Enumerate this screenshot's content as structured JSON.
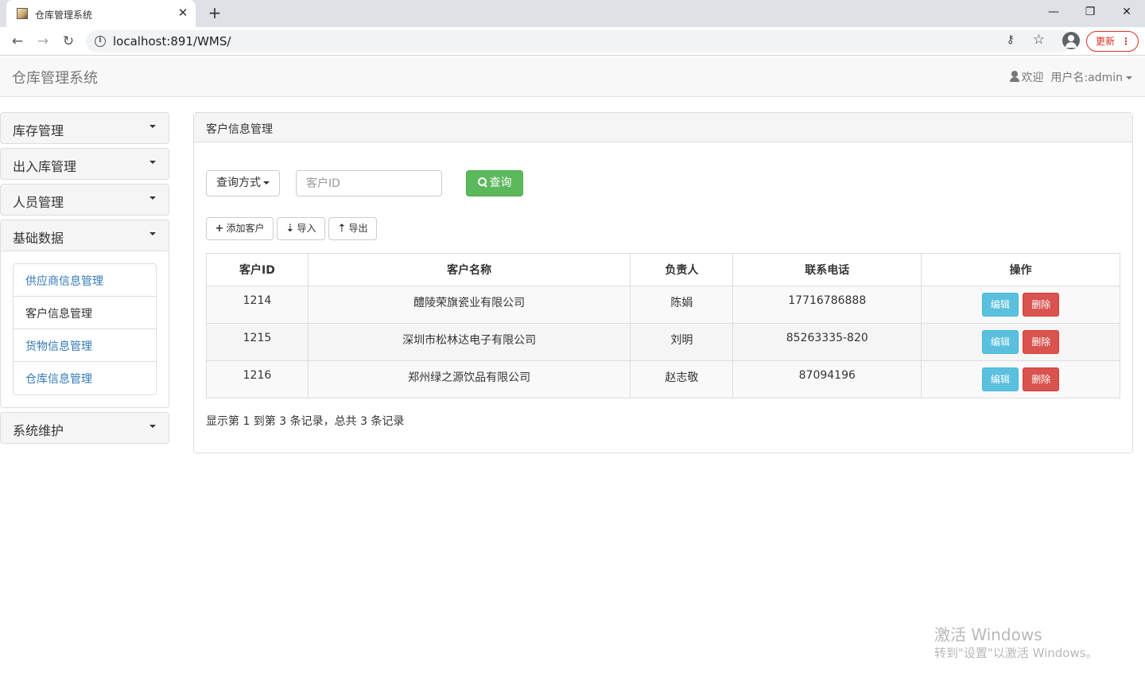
{
  "browser": {
    "tab_title": "仓库管理系统",
    "tab_close": "✕",
    "new_tab": "+",
    "url": "localhost:891/WMS/",
    "update_label": "更新",
    "window_controls": {
      "minimize": "—",
      "restore": "❐",
      "close": "✕"
    }
  },
  "app": {
    "brand": "仓库管理系统",
    "welcome": "欢迎",
    "username": "用户名:admin"
  },
  "sidebar": {
    "groups": [
      {
        "label": "库存管理"
      },
      {
        "label": "出入库管理"
      },
      {
        "label": "人员管理"
      },
      {
        "label": "基础数据",
        "expanded": true
      },
      {
        "label": "系统维护"
      }
    ],
    "basic_items": [
      {
        "label": "供应商信息管理"
      },
      {
        "label": "客户信息管理",
        "active": true
      },
      {
        "label": "货物信息管理"
      },
      {
        "label": "仓库信息管理"
      }
    ]
  },
  "main": {
    "heading": "客户信息管理",
    "query_mode_label": "查询方式",
    "search_placeholder": "客户ID",
    "query_button": "查询",
    "add_button": "添加客户",
    "import_button": "导入",
    "export_button": "导出",
    "columns": [
      "客户ID",
      "客户名称",
      "负责人",
      "联系电话",
      "操作"
    ],
    "rows": [
      {
        "id": "1214",
        "name": "醴陵荣旗瓷业有限公司",
        "manager": "陈娟",
        "phone": "17716786888"
      },
      {
        "id": "1215",
        "name": "深圳市松林达电子有限公司",
        "manager": "刘明",
        "phone": "85263335-820"
      },
      {
        "id": "1216",
        "name": "郑州绿之源饮品有限公司",
        "manager": "赵志敬",
        "phone": "87094196"
      }
    ],
    "edit_label": "编辑",
    "delete_label": "删除",
    "page_info": "显示第 1 到第 3 条记录，总共 3 条记录"
  },
  "watermark": {
    "line1": "激活 Windows",
    "line2": "转到\"设置\"以激活 Windows。"
  },
  "colors": {
    "success": "#5cb85c",
    "info": "#5bc0de",
    "danger": "#d9534f",
    "link": "#337ab7"
  }
}
